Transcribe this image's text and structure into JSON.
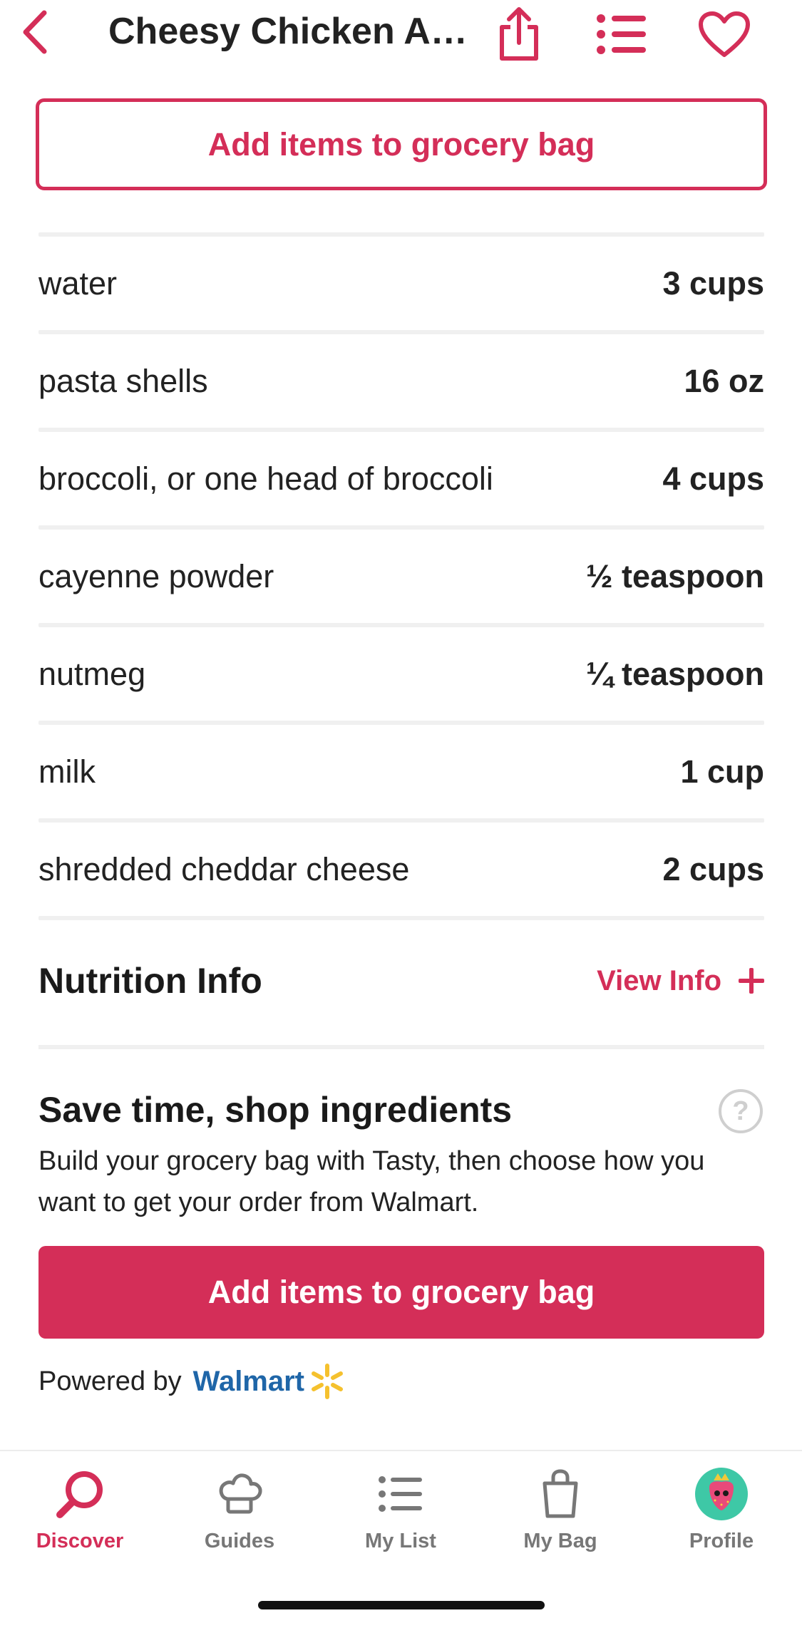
{
  "header": {
    "title": "Cheesy Chicken A…"
  },
  "top_button": {
    "label": "Add items to grocery bag"
  },
  "ingredients": [
    {
      "name": "water",
      "qty": "3 cups"
    },
    {
      "name": "pasta shells",
      "qty": "16 oz"
    },
    {
      "name": "broccoli, or one head of broccoli",
      "qty": "4 cups"
    },
    {
      "name": "cayenne powder",
      "qty": "½ teaspoon"
    },
    {
      "name": "nutmeg",
      "qty": "¼ teaspoon"
    },
    {
      "name": "milk",
      "qty": "1 cup"
    },
    {
      "name": "shredded cheddar cheese",
      "qty": "2 cups"
    }
  ],
  "nutrition": {
    "title": "Nutrition Info",
    "view_label": "View Info"
  },
  "shop": {
    "title": "Save time, shop ingredients",
    "help_glyph": "?",
    "description": "Build your grocery bag with Tasty, then choose how you want to get your order from Walmart.",
    "button_label": "Add items to grocery bag",
    "powered_by": "Powered by",
    "brand": "Walmart"
  },
  "tabs": [
    {
      "label": "Discover",
      "icon": "search-icon",
      "active": true
    },
    {
      "label": "Guides",
      "icon": "chef-hat-icon",
      "active": false
    },
    {
      "label": "My List",
      "icon": "list-icon",
      "active": false
    },
    {
      "label": "My Bag",
      "icon": "bag-icon",
      "active": false
    },
    {
      "label": "Profile",
      "icon": "strawberry-avatar-icon",
      "active": false
    }
  ],
  "colors": {
    "accent": "#d42e58",
    "walmart_blue": "#1f66a8",
    "walmart_yellow": "#f5c12e",
    "inactive_tab": "#777777"
  }
}
